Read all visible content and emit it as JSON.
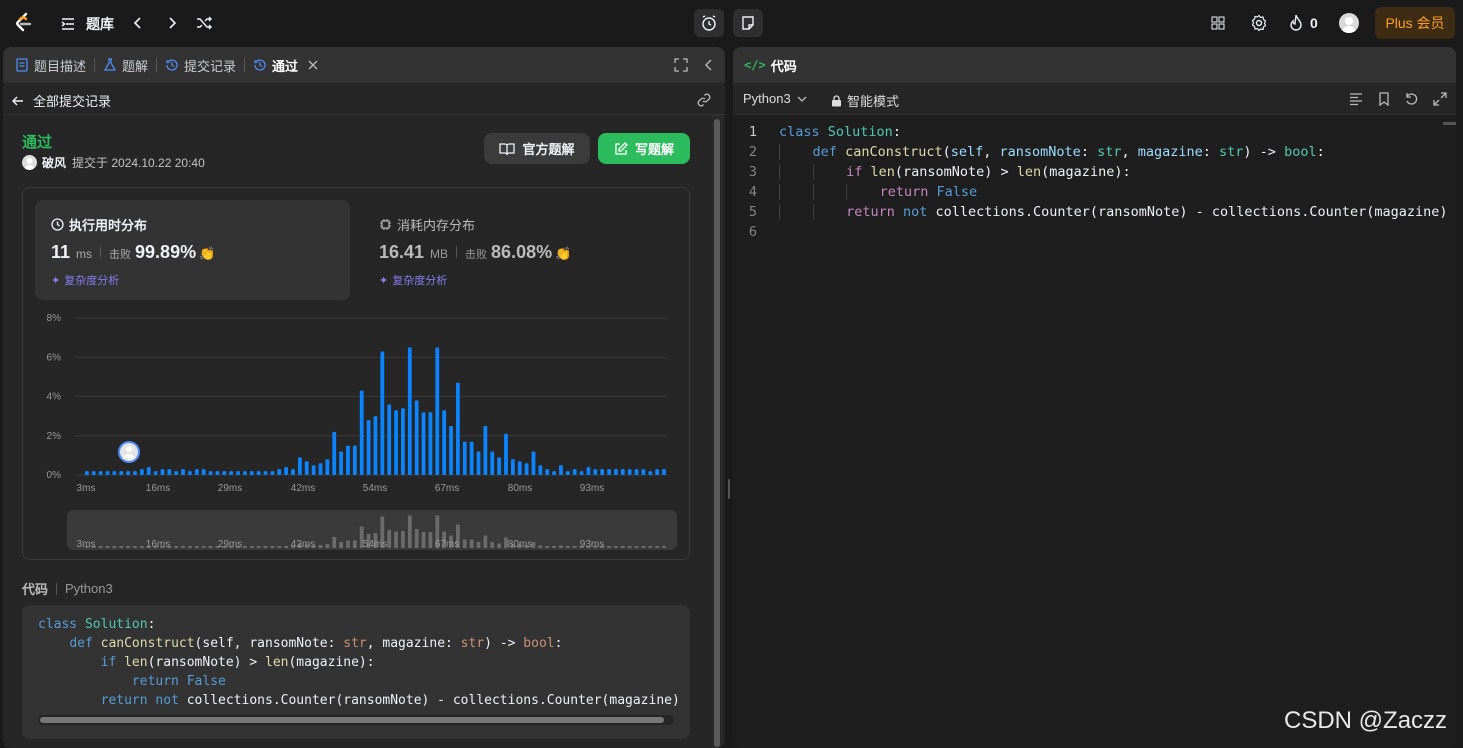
{
  "topbar": {
    "title": "题库",
    "fire_count": "0",
    "plus_label": "Plus 会员"
  },
  "left": {
    "tabs": [
      {
        "label": "题目描述"
      },
      {
        "label": "题解"
      },
      {
        "label": "提交记录"
      },
      {
        "label": "通过"
      }
    ],
    "back_label": "全部提交记录",
    "status": "通过",
    "user": "破风",
    "submitted_at": "提交于 2024.10.22 20:40",
    "official_btn": "官方题解",
    "write_btn": "写题解",
    "runtime": {
      "title": "执行用时分布",
      "value": "11",
      "unit": "ms",
      "beat_label": "击败",
      "beat": "99.89%",
      "analysis": "复杂度分析"
    },
    "memory": {
      "title": "消耗内存分布",
      "value": "16.41",
      "unit": "MB",
      "beat_label": "击败",
      "beat": "86.08%",
      "analysis": "复杂度分析"
    },
    "code_header": "代码",
    "code_lang": "Python3"
  },
  "right": {
    "title": "代码",
    "lang": "Python3",
    "mode": "智能模式",
    "lines": [
      "1",
      "2",
      "3",
      "4",
      "5",
      "6"
    ]
  },
  "watermark": "CSDN @Zaczz",
  "colors": {
    "accent_green": "#2cbb5d",
    "bar_blue": "#0a84ff",
    "plus_orange": "#ffa116"
  },
  "chart_data": {
    "type": "bar",
    "x_ticks": [
      "3ms",
      "16ms",
      "29ms",
      "42ms",
      "54ms",
      "67ms",
      "80ms",
      "93ms"
    ],
    "y_ticks": [
      "0%",
      "2%",
      "4%",
      "6%",
      "8%"
    ],
    "ylim": [
      0,
      8
    ],
    "values": [
      0.2,
      0.2,
      0.2,
      0.2,
      0.2,
      0.2,
      0.2,
      0.2,
      0.3,
      0.4,
      0.2,
      0.3,
      0.3,
      0.2,
      0.3,
      0.2,
      0.3,
      0.3,
      0.2,
      0.2,
      0.2,
      0.2,
      0.2,
      0.2,
      0.2,
      0.2,
      0.2,
      0.2,
      0.3,
      0.4,
      0.3,
      0.9,
      0.7,
      0.5,
      0.6,
      0.8,
      2.2,
      1.2,
      1.5,
      1.5,
      4.3,
      2.8,
      3.0,
      6.3,
      3.6,
      3.3,
      3.4,
      6.5,
      3.8,
      3.2,
      3.2,
      6.5,
      3.3,
      2.5,
      4.7,
      1.7,
      1.7,
      1.2,
      2.5,
      1.2,
      0.9,
      2.1,
      0.8,
      0.7,
      0.6,
      1.2,
      0.5,
      0.3,
      0.2,
      0.5,
      0.2,
      0.3,
      0.2,
      0.4,
      0.3,
      0.3,
      0.3,
      0.3,
      0.3,
      0.3,
      0.3,
      0.3,
      0.2,
      0.3,
      0.3
    ],
    "current_marker": "11ms"
  }
}
